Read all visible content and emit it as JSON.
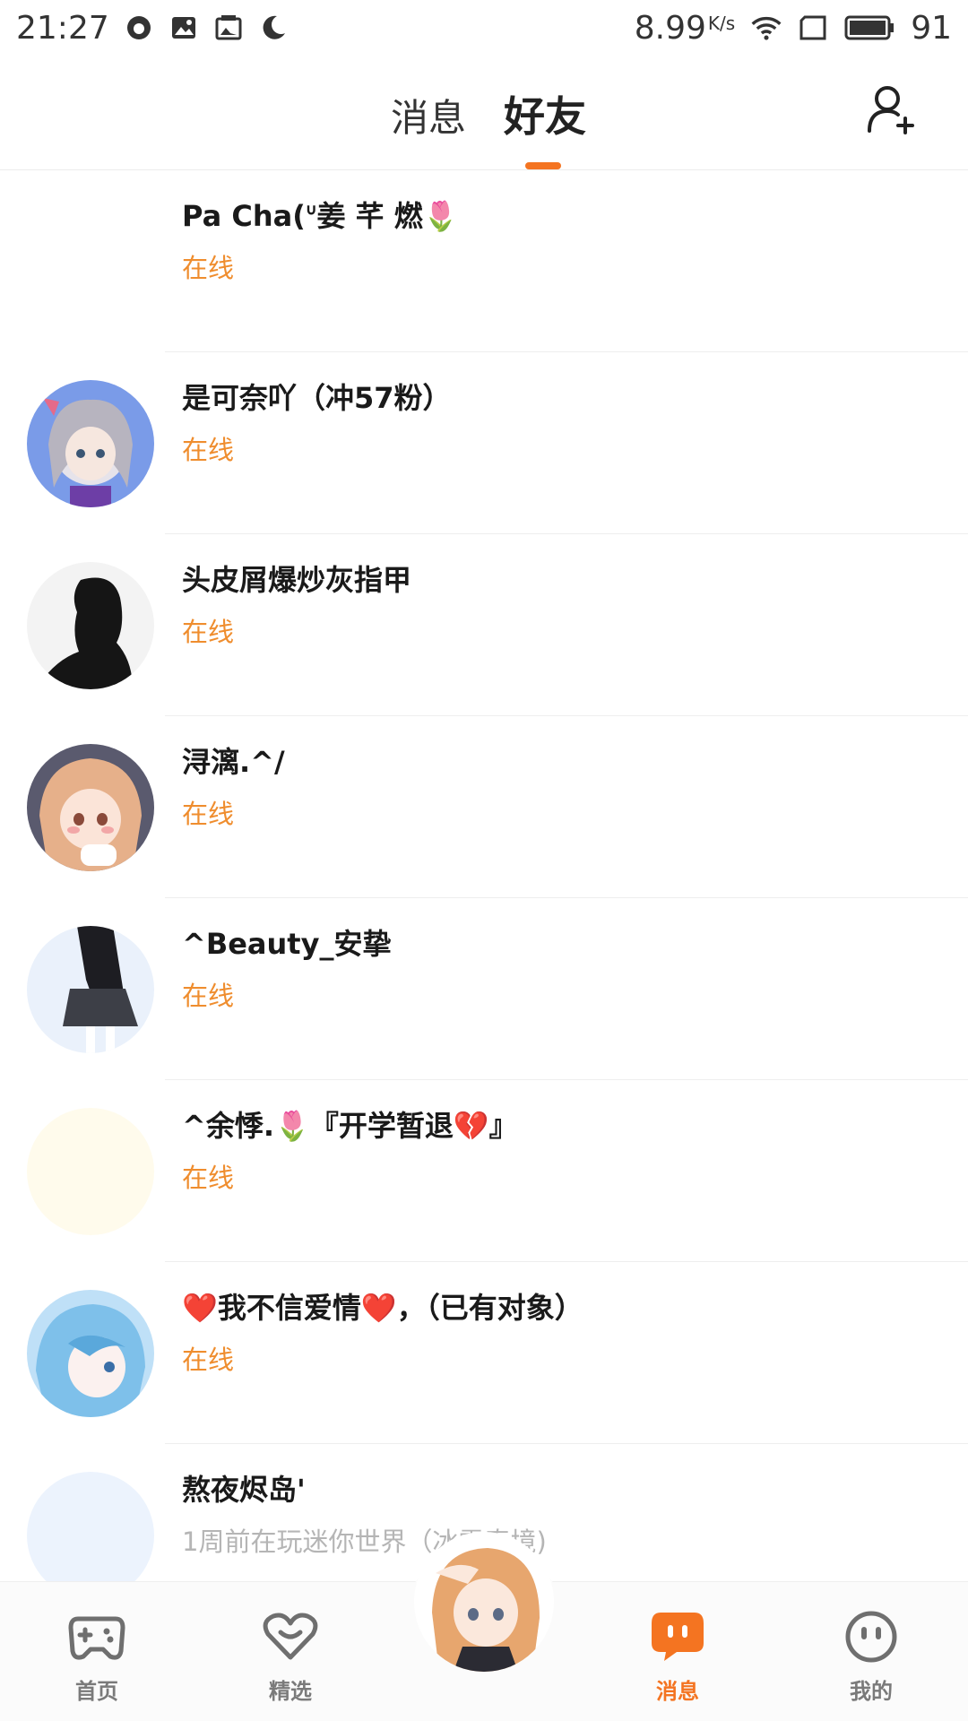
{
  "status_bar": {
    "time": "21:27",
    "net_speed": "8.99",
    "net_unit": "K/s",
    "battery": "91"
  },
  "header": {
    "tabs": [
      {
        "label": "消息",
        "active": false
      },
      {
        "label": "好友",
        "active": true
      }
    ],
    "accent_color": "#f47421"
  },
  "friends": [
    {
      "name": "Pa Cha(ᐡ姜 芊 燃🌷",
      "status": "在线",
      "avatar": "none"
    },
    {
      "name": "是可奈吖（冲57粉）",
      "status": "在线",
      "avatar": "anime-girl-silver-hair"
    },
    {
      "name": "头皮屑爆炒灰指甲",
      "status": "在线",
      "avatar": "silhouette-girl"
    },
    {
      "name": "浔漓.^/",
      "status": "在线",
      "avatar": "anime-girl-ginger"
    },
    {
      "name": "^Beauty_安挚",
      "status": "在线",
      "avatar": "anime-girl-skirt"
    },
    {
      "name": "^余悸.🌷『开学暂退💔』",
      "status": "在线",
      "avatar": "blank-light"
    },
    {
      "name": "❤️我不信爱情❤️，（已有对象）",
      "status": "在线",
      "avatar": "anime-girl-blue-hair"
    },
    {
      "name": "熬夜烬岛'",
      "status": "1周前在玩迷你世界（冰雪奇境)",
      "avatar": "blank-blue"
    }
  ],
  "bottom_nav": {
    "items": [
      {
        "label": "首页",
        "icon": "gamepad-icon",
        "active": false
      },
      {
        "label": "精选",
        "icon": "heart-icon",
        "active": false
      },
      {
        "label": "消息",
        "icon": "chat-bubble-icon",
        "active": true
      },
      {
        "label": "我的",
        "icon": "smiley-face-icon",
        "active": false
      }
    ],
    "center": "character-avatar"
  }
}
